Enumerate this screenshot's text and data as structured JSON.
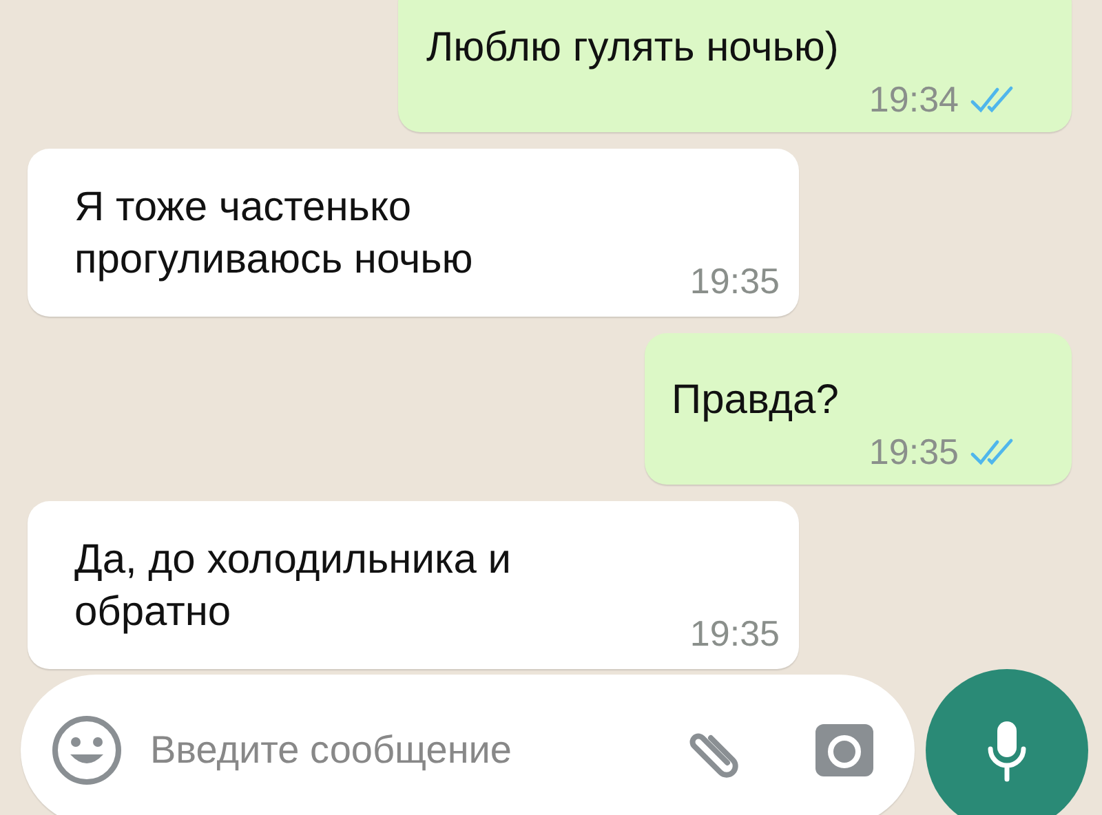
{
  "messages": [
    {
      "kind": "outgoing",
      "text": "Люблю гулять ночью)",
      "time": "19:34",
      "read": true
    },
    {
      "kind": "incoming",
      "text": "Я тоже частенько прогуливаюсь ночью",
      "time": "19:35"
    },
    {
      "kind": "outgoing",
      "text": "Правда?",
      "time": "19:35",
      "read": true
    },
    {
      "kind": "incoming",
      "text": "Да, до холодильника и обратно",
      "time": "19:35"
    }
  ],
  "composer": {
    "placeholder": "Введите сообщение"
  }
}
